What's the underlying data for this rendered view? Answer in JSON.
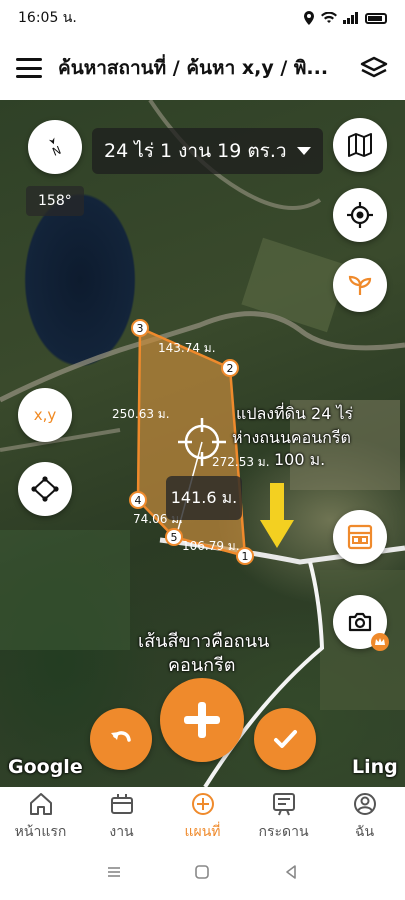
{
  "status_bar": {
    "time": "16:05 น."
  },
  "header": {
    "title": "ค้นหาสถานที่ / ค้นหา x,y / พิ..."
  },
  "map": {
    "area_label": "24 ไร่ 1 งาน 19 ตร.ว",
    "compass_angle": "158°",
    "xy_button_label": "x,y",
    "center_distance": "141.6 ม.",
    "edge_lengths": [
      "143.74 ม.",
      "250.63 ม.",
      "272.53 ม.",
      "74.06 ม.",
      "106.79 ม."
    ],
    "vertex_labels": [
      "1",
      "2",
      "3",
      "4",
      "5"
    ],
    "annotation_lines": [
      "แปลงที่ดิน 24 ไร่",
      "ห่างถนนคอนกรีต",
      "100 ม."
    ],
    "road_note_lines": [
      "เส้นสีขาวคือถนน",
      "คอนกรีต"
    ],
    "google_logo": "Google",
    "ling_logo": "Ling",
    "accent_color": "#ef8a2c",
    "plot_fill_color": "#c48a3c"
  },
  "bottom_nav": {
    "items": [
      {
        "label": "หน้าแรก",
        "icon": "home-icon"
      },
      {
        "label": "งาน",
        "icon": "briefcase-icon"
      },
      {
        "label": "แผนที่",
        "icon": "add-circle-icon"
      },
      {
        "label": "กระดาน",
        "icon": "board-icon"
      },
      {
        "label": "ฉัน",
        "icon": "user-icon"
      }
    ],
    "active_index": 2
  }
}
